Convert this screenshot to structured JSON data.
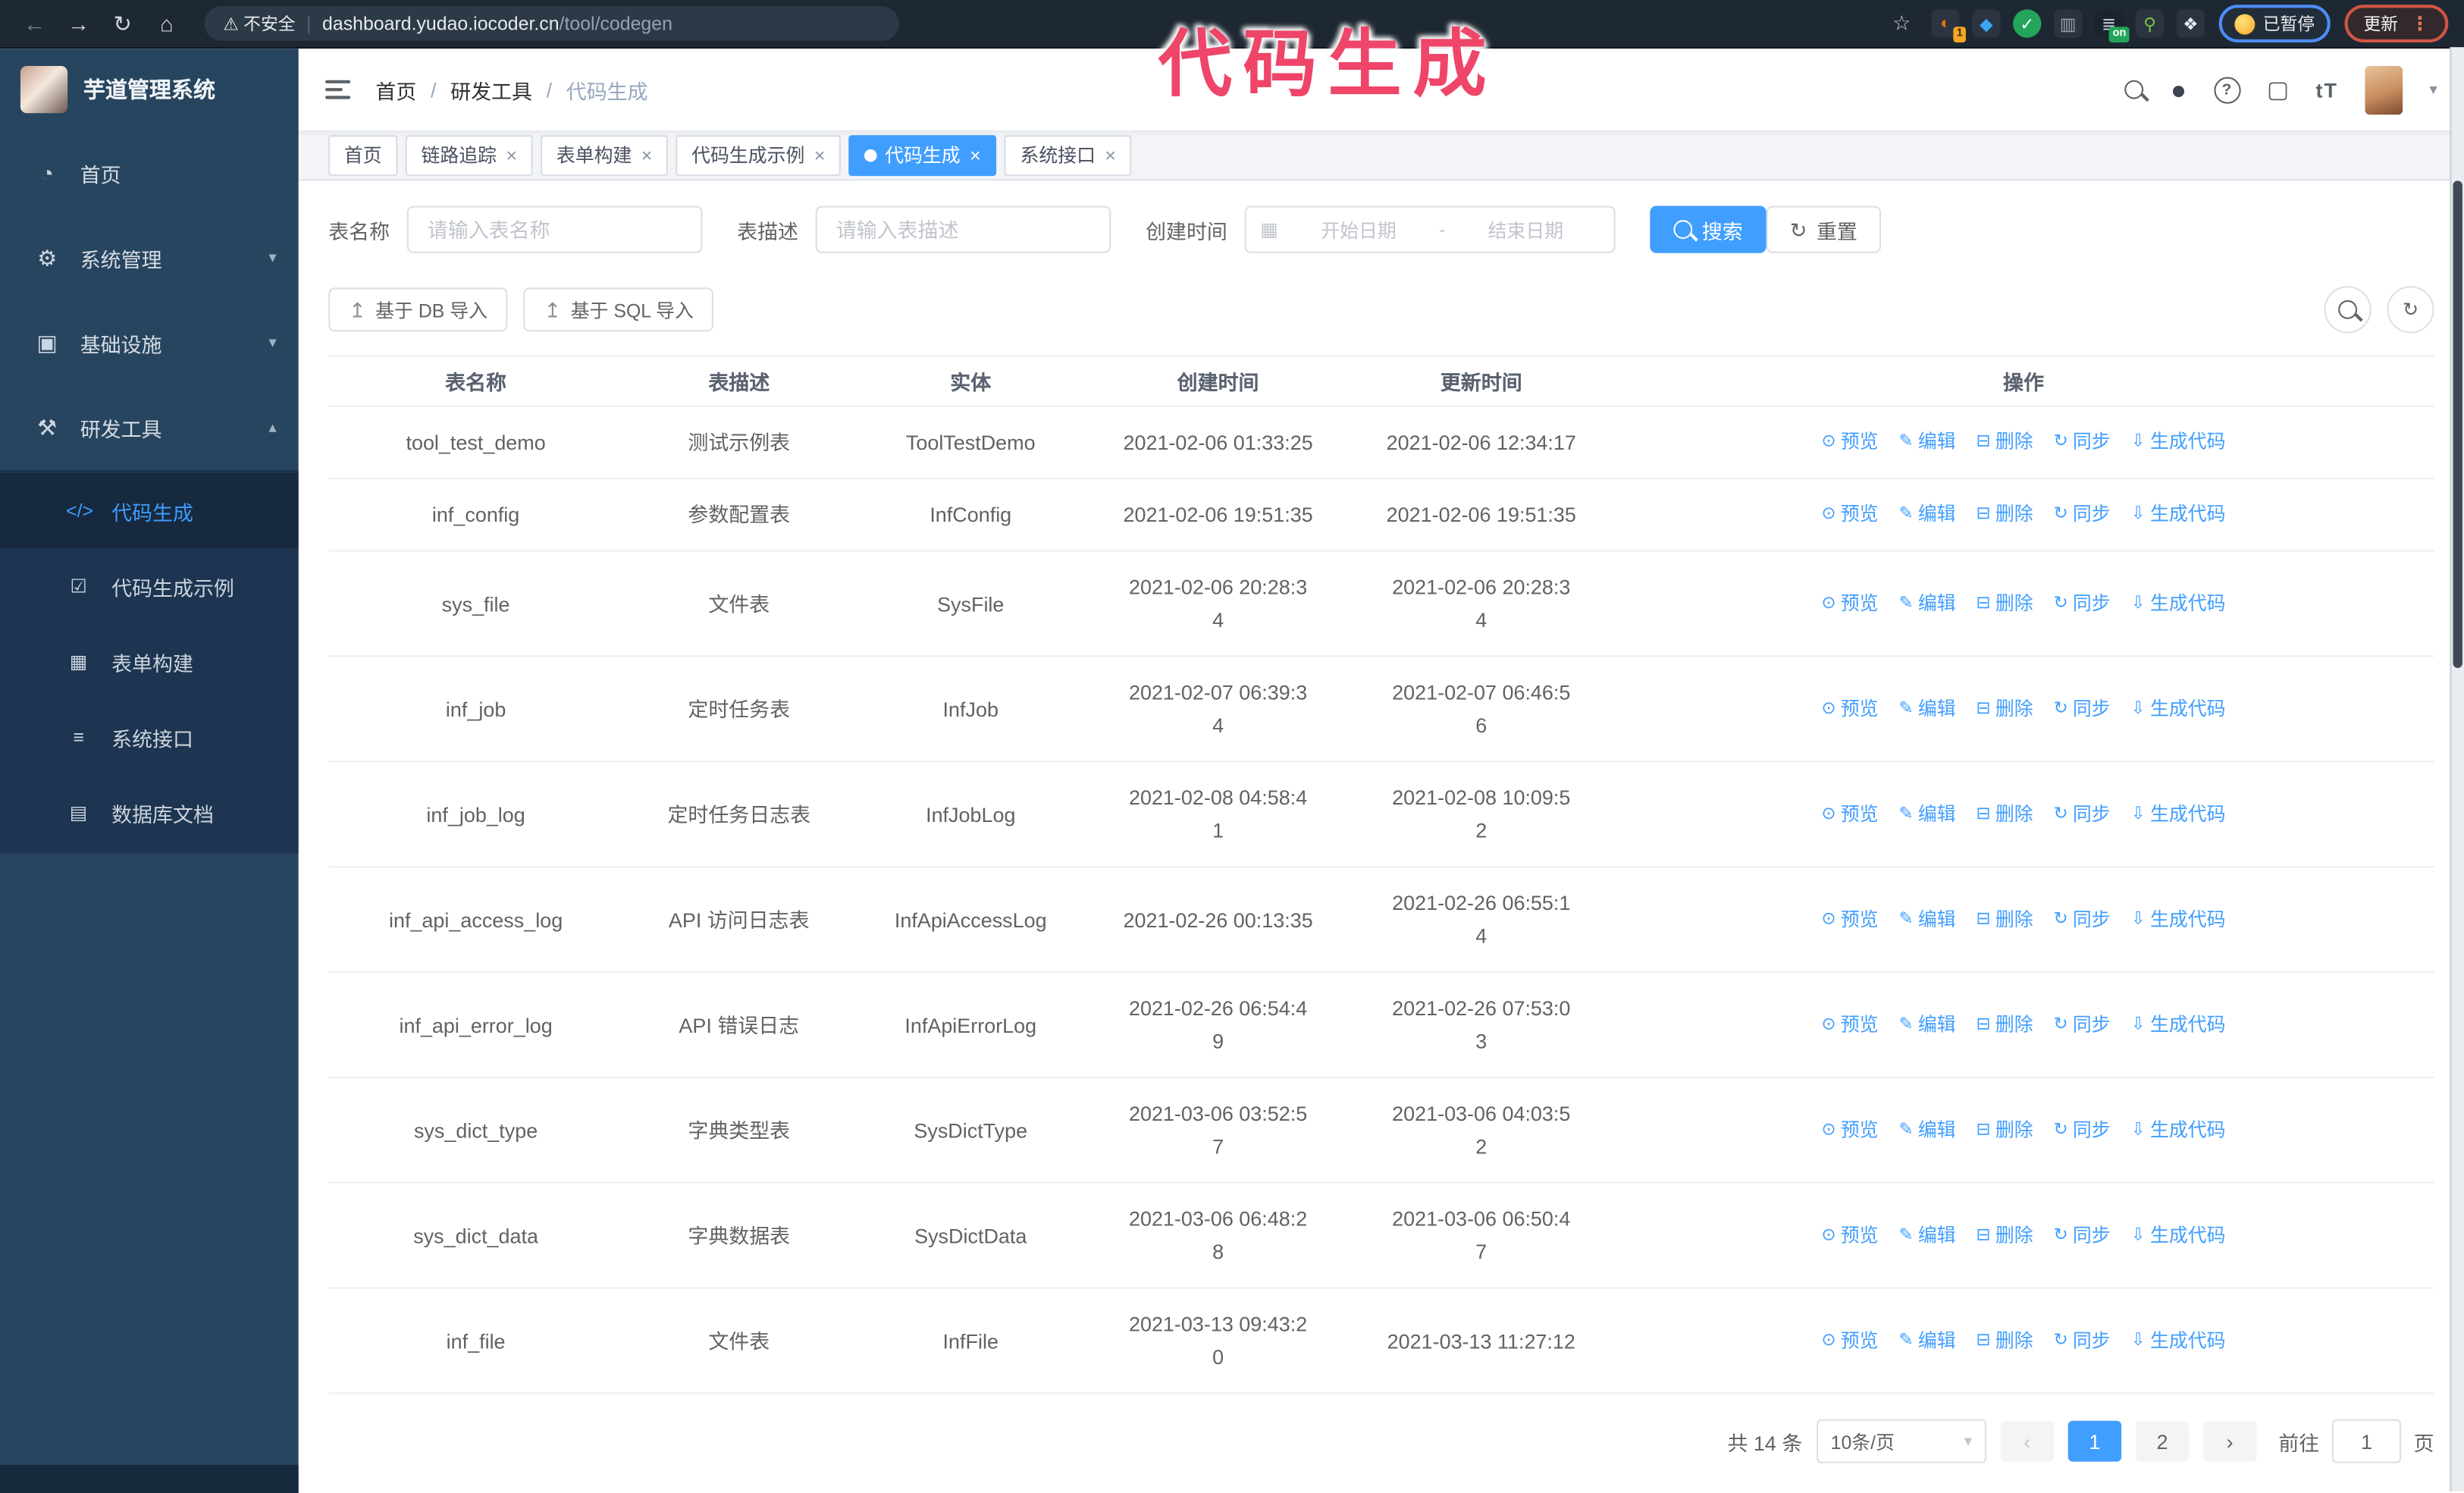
{
  "colors": {
    "accent": "#409eff",
    "annotation": "#ee4568",
    "sidebar_bg": "#28455f",
    "submenu_bg": "#1d3550"
  },
  "annotation": {
    "text": "代码生成"
  },
  "browser": {
    "security_label": "不安全",
    "url_domain": "dashboard.yudao.iocoder.cn",
    "url_path": "/tool/codegen",
    "nav": {
      "back": "←",
      "forward": "→",
      "reload": "↻",
      "home": "⌂",
      "warning": "⚠",
      "star": "☆",
      "kebab": "⋮"
    },
    "profile_chip": "已暂停",
    "update_label": "更新",
    "extensions": [
      {
        "id": "ext-orange",
        "icon": "orange-extension-icon",
        "glyph": "◐",
        "bg": "#2b3440",
        "fg": "#e8710a",
        "badge": "1",
        "badge_green": false
      },
      {
        "id": "ext-gem",
        "icon": "blue-gem-extension-icon",
        "glyph": "◆",
        "bg": "#2b3440",
        "fg": "#38a6f5"
      },
      {
        "id": "ext-check",
        "icon": "green-check-extension-icon",
        "glyph": "✓",
        "bg": "#23a55a",
        "fg": "#ffffff",
        "round": true
      },
      {
        "id": "ext-sliders",
        "icon": "sliders-extension-icon",
        "glyph": "▥",
        "bg": "#2b3440",
        "fg": "#9aa6b2"
      },
      {
        "id": "ext-dark",
        "icon": "dark-extension-icon",
        "glyph": "≣",
        "bg": "#1b242e",
        "fg": "#cfd6dd",
        "badge": "on",
        "badge_green": true
      },
      {
        "id": "ext-key",
        "icon": "key-extension-icon",
        "glyph": "⚲",
        "bg": "#2b3440",
        "fg": "#7ac143"
      },
      {
        "id": "ext-puzzle",
        "icon": "puzzle-extension-icon",
        "glyph": "❖",
        "bg": "#2b3440",
        "fg": "#e8eaed"
      }
    ]
  },
  "app": {
    "title": "芋道管理系统"
  },
  "breadcrumb": {
    "items": [
      "首页",
      "研发工具",
      "代码生成"
    ],
    "separator": "/"
  },
  "header_icons": {
    "github": "●",
    "help": "?",
    "fullscreen": "▢",
    "font_size": "tT",
    "caret": "▾"
  },
  "sidebar": {
    "items": [
      {
        "id": "home",
        "icon": "dashboard-icon",
        "glyph": "◔",
        "label": "首页",
        "arrow": ""
      },
      {
        "id": "system",
        "icon": "gear-icon",
        "glyph": "⚙",
        "label": "系统管理",
        "arrow": "▾"
      },
      {
        "id": "infra",
        "icon": "monitor-icon",
        "glyph": "▣",
        "label": "基础设施",
        "arrow": "▾"
      },
      {
        "id": "devtools",
        "icon": "toolbox-icon",
        "glyph": "⚒",
        "label": "研发工具",
        "arrow": "▴",
        "active": true
      }
    ],
    "submenu": [
      {
        "id": "codegen",
        "icon": "code-icon",
        "glyph": "</>",
        "label": "代码生成",
        "active": true
      },
      {
        "id": "codegen-demo",
        "icon": "check-doc-icon",
        "glyph": "☑",
        "label": "代码生成示例"
      },
      {
        "id": "form-build",
        "icon": "form-grid-icon",
        "glyph": "▦",
        "label": "表单构建"
      },
      {
        "id": "system-api",
        "icon": "api-lines-icon",
        "glyph": "≡",
        "label": "系统接口"
      },
      {
        "id": "db-doc",
        "icon": "database-table-icon",
        "glyph": "▤",
        "label": "数据库文档"
      }
    ]
  },
  "tabs": [
    {
      "id": "home",
      "label": "首页",
      "closable": false,
      "active": false
    },
    {
      "id": "tracing",
      "label": "链路追踪",
      "closable": true,
      "active": false
    },
    {
      "id": "form-build",
      "label": "表单构建",
      "closable": true,
      "active": false
    },
    {
      "id": "codegen-demo",
      "label": "代码生成示例",
      "closable": true,
      "active": false
    },
    {
      "id": "codegen",
      "label": "代码生成",
      "closable": true,
      "active": true
    },
    {
      "id": "system-api",
      "label": "系统接口",
      "closable": true,
      "active": false
    }
  ],
  "search": {
    "name_label": "表名称",
    "name_placeholder": "请输入表名称",
    "desc_label": "表描述",
    "desc_placeholder": "请输入表描述",
    "date_label": "创建时间",
    "date_start": "开始日期",
    "date_separator": "-",
    "date_end": "结束日期",
    "calendar_glyph": "▦",
    "search_label": "搜索",
    "reset_label": "重置",
    "reset_glyph": "↻"
  },
  "toolbar": {
    "db_import_label": "基于 DB 导入",
    "sql_import_label": "基于 SQL 导入",
    "import_glyph": "↥",
    "refresh_glyph": "↻"
  },
  "table": {
    "columns": [
      "表名称",
      "表描述",
      "实体",
      "创建时间",
      "更新时间",
      "操作"
    ],
    "actions": [
      {
        "name": "preview-link",
        "icon": "eye-icon",
        "glyph": "⊙",
        "label": "预览"
      },
      {
        "name": "edit-link",
        "icon": "edit-pencil-icon",
        "glyph": "✎",
        "label": "编辑"
      },
      {
        "name": "delete-link",
        "icon": "trash-icon",
        "glyph": "⊟",
        "label": "删除"
      },
      {
        "name": "sync-link",
        "icon": "sync-icon",
        "glyph": "↻",
        "label": "同步"
      },
      {
        "name": "generate-code-link",
        "icon": "download-icon",
        "glyph": "⇩",
        "label": "生成代码"
      }
    ],
    "rows": [
      {
        "name": "tool_test_demo",
        "desc": "测试示例表",
        "entity": "ToolTestDemo",
        "created": "2021-02-06 01:33:25",
        "updated": "2021-02-06 12:34:17"
      },
      {
        "name": "inf_config",
        "desc": "参数配置表",
        "entity": "InfConfig",
        "created": "2021-02-06 19:51:35",
        "updated": "2021-02-06 19:51:35"
      },
      {
        "name": "sys_file",
        "desc": "文件表",
        "entity": "SysFile",
        "created": "2021-02-06 20:28:3\n4",
        "updated": "2021-02-06 20:28:3\n4"
      },
      {
        "name": "inf_job",
        "desc": "定时任务表",
        "entity": "InfJob",
        "created": "2021-02-07 06:39:3\n4",
        "updated": "2021-02-07 06:46:5\n6"
      },
      {
        "name": "inf_job_log",
        "desc": "定时任务日志表",
        "entity": "InfJobLog",
        "created": "2021-02-08 04:58:4\n1",
        "updated": "2021-02-08 10:09:5\n2"
      },
      {
        "name": "inf_api_access_log",
        "desc": "API 访问日志表",
        "entity": "InfApiAccessLog",
        "created": "2021-02-26 00:13:35",
        "updated": "2021-02-26 06:55:1\n4"
      },
      {
        "name": "inf_api_error_log",
        "desc": "API 错误日志",
        "entity": "InfApiErrorLog",
        "created": "2021-02-26 06:54:4\n9",
        "updated": "2021-02-26 07:53:0\n3"
      },
      {
        "name": "sys_dict_type",
        "desc": "字典类型表",
        "entity": "SysDictType",
        "created": "2021-03-06 03:52:5\n7",
        "updated": "2021-03-06 04:03:5\n2"
      },
      {
        "name": "sys_dict_data",
        "desc": "字典数据表",
        "entity": "SysDictData",
        "created": "2021-03-06 06:48:2\n8",
        "updated": "2021-03-06 06:50:4\n7"
      },
      {
        "name": "inf_file",
        "desc": "文件表",
        "entity": "InfFile",
        "created": "2021-03-13 09:43:2\n0",
        "updated": "2021-03-13 11:27:12"
      }
    ]
  },
  "pagination": {
    "total": "共 14 条",
    "page_size": "10条/页",
    "prev": "‹",
    "next": "›",
    "pages": [
      "1",
      "2"
    ],
    "active_page": "1",
    "goto_label": "前往",
    "goto_value": "1",
    "goto_suffix": "页",
    "caret": "▾"
  }
}
